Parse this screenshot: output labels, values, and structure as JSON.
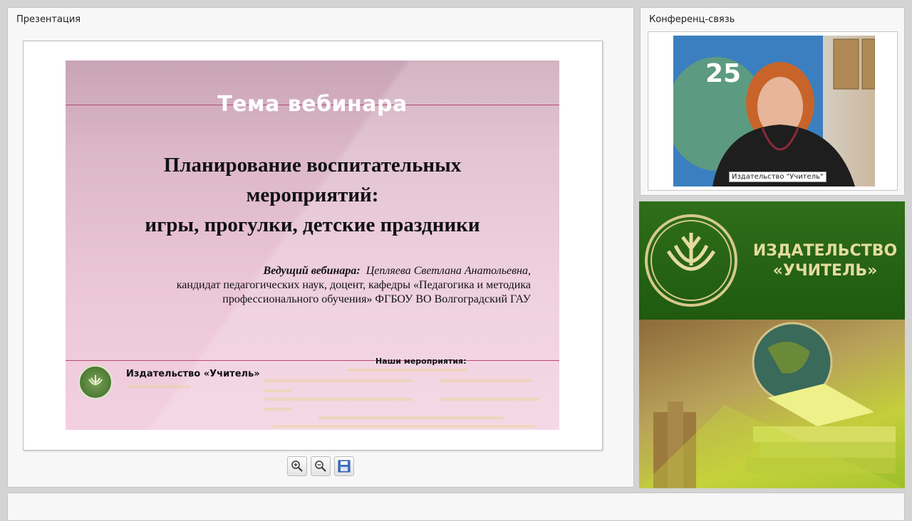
{
  "presentation_panel": {
    "title": "Презентация"
  },
  "slide": {
    "topic_heading": "Тема вебинара",
    "title_lines": [
      "Планирование воспитательных",
      "мероприятий:",
      "игры, прогулки, детские праздники"
    ],
    "host_label": "Ведущий вебинара:",
    "host_name": "Цепляева Светлана Анатольевна,",
    "host_details": [
      "кандидат педагогических наук,  доцент, кафедры «Педагогика и методика",
      "профессионального обучения» ФГБОУ ВО Волгоградский ГАУ"
    ],
    "publisher": "Издательство «Учитель»",
    "events_label": "Наши мероприятия:"
  },
  "toolbar": {
    "buttons": [
      "zoom-in-icon",
      "zoom-out-icon",
      "save-icon"
    ]
  },
  "conference_panel": {
    "title": "Конференц-связь",
    "participant_name": "Издательство \"Учитель\""
  },
  "banner": {
    "publisher_line1": "ИЗДАТЕЛЬСТВО",
    "publisher_line2": "«УЧИТЕЛЬ»"
  },
  "colors": {
    "slide_accent": "#b24b6d",
    "banner_green": "#2f6e1a",
    "banner_text": "#e4dba0"
  }
}
